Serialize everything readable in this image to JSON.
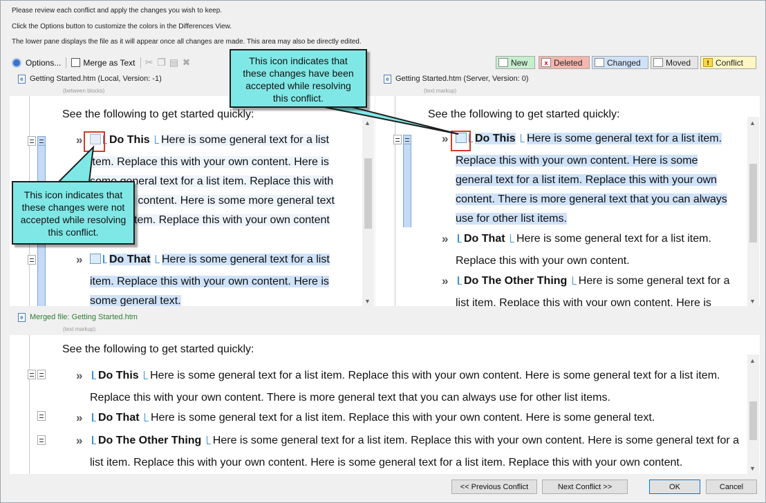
{
  "instructions": [
    "Please review each conflict and apply the changes you wish to keep.",
    "Click the Options button to customize the colors in the Differences View.",
    "The lower pane displays the file as it will appear once all changes are made. This area may also be directly edited."
  ],
  "toolbar": {
    "options_label": "Options...",
    "merge_label": "Merge as Text"
  },
  "legend": {
    "new": "New",
    "deleted": "Deleted",
    "changed": "Changed",
    "moved": "Moved",
    "conflict": "Conflict"
  },
  "left_pane": {
    "title": "Getting Started.htm (Local, Version: -1)",
    "sub": "(between blocks)",
    "top_line": "See the following to get started quickly:",
    "item1_head": "Do This",
    "item1_lines": [
      "Here is some general text for a list",
      "item. Replace this with your own content. Here is",
      "some general text for a list item. Replace this with",
      "your own content. Here is some more general text",
      "for a list item. Replace this with your own content"
    ],
    "item2_head": "Do That",
    "item2_lines": [
      "Here is some general text for a list",
      "item. Replace this with your own content. Here is",
      "some general text."
    ]
  },
  "right_pane": {
    "title": "Getting Started.htm (Server, Version: 0)",
    "sub": "(text markup)",
    "top_line": "See the following to get started quickly:",
    "item1_head": "Do This",
    "item1_lines": [
      "Here is some general text for a list item.",
      "Replace this with your own content. Here is some",
      "general text for a list item. Replace this with your own",
      "content. There is more general text that you can always",
      "use for other list items."
    ],
    "item2_head": "Do That",
    "item2_lines": [
      "Here is some general text for a list item.",
      "Replace this with your own content."
    ],
    "item3_head": "Do The Other Thing",
    "item3_lines": [
      "Here is some general text for a",
      "list item. Replace this with your own content. Here is"
    ]
  },
  "merged_pane": {
    "title": "Merged file: Getting Started.htm",
    "sub": "(text markup)",
    "top_line": "See the following to get started quickly:",
    "item1_head": "Do This",
    "item1_lines": [
      "Here is some general text for a list item. Replace this with your own content. Here is some general text for a list item.",
      "Replace this with your own content. There is more general text that you can always use for other list items."
    ],
    "item2_head": "Do That",
    "item2_line": "Here is some general text for a list item. Replace this with your own content. Here is some general text.",
    "item3_head": "Do The Other Thing",
    "item3_lines": [
      "Here is some general text for a list item. Replace this with your own content. Here is some general text for a",
      "list item. Replace this with your own content. Here is some general text for a list item. Replace this with your own content."
    ]
  },
  "callouts": {
    "accepted": "This icon indicates that these changes have been accepted while resolving this conflict.",
    "not_accepted": "This icon indicates that these changes were not accepted while resolving this conflict."
  },
  "buttons": {
    "prev": "<< Previous Conflict",
    "next": "Next Conflict >>",
    "ok": "OK",
    "cancel": "Cancel"
  },
  "colors": {
    "highlight": "#cfe2f8",
    "callout": "#7fe8e6",
    "callout_border": "#d53a24",
    "new": "#c6efce",
    "deleted": "#f4b6ad",
    "changed": "#cfe2f8",
    "moved": "#e6e6e6",
    "conflict": "#fff6c4"
  }
}
